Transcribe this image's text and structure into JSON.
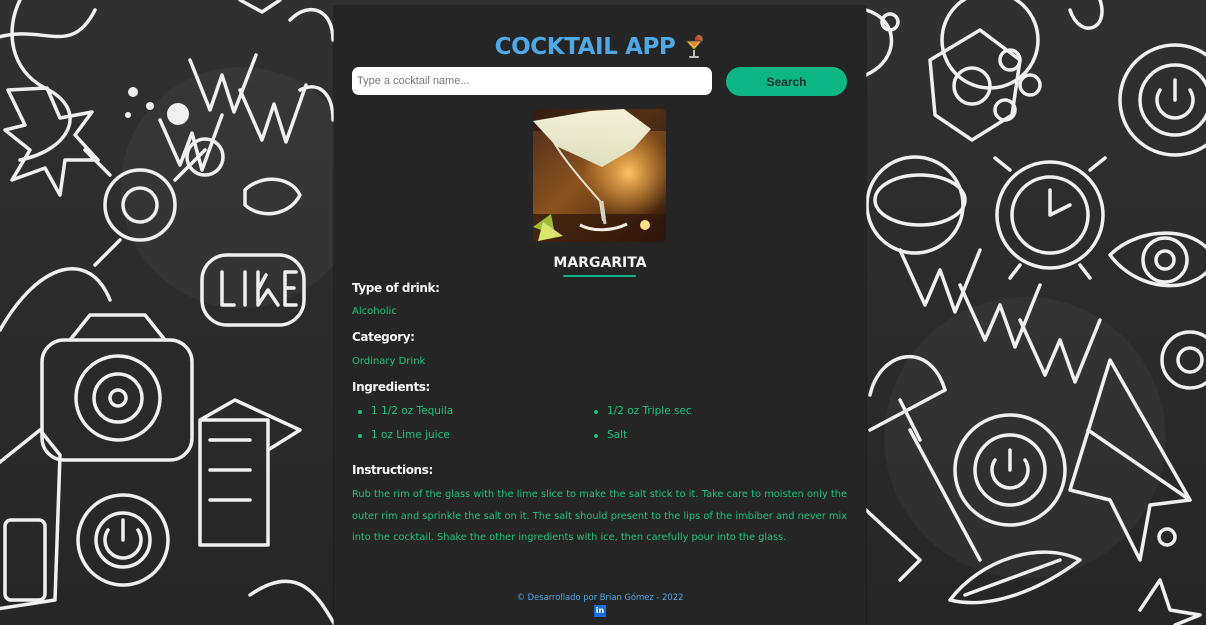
{
  "app": {
    "title": "COCKTAIL APP"
  },
  "search": {
    "placeholder": "Type a cocktail name...",
    "button_label": "Search"
  },
  "drink": {
    "name": "MARGARITA",
    "image_icon": "margarita-cocktail-photo"
  },
  "details": {
    "type_label": "Type of drink:",
    "type_value": "Alcoholic",
    "category_label": "Category:",
    "category_value": "Ordinary Drink",
    "ingredients_label": "Ingredients:",
    "ingredients": [
      "1 1/2 oz Tequila",
      "1/2 oz Triple sec",
      "1 oz Lime juice",
      "Salt"
    ],
    "instructions_label": "Instructions:",
    "instructions": "Rub the rim of the glass with the lime slice to make the salt stick to it. Take care to moisten only the outer rim and sprinkle the salt on it. The salt should present to the lips of the imbiber and never mix into the cocktail. Shake the other ingredients with ice, then carefully pour into the glass."
  },
  "footer": {
    "text": "© Desarrollado por Brian Gómez - 2022",
    "linkedin_label": "in"
  },
  "colors": {
    "accent_blue": "#4ea8e6",
    "accent_green": "#20c27f",
    "button_green": "#0fb685",
    "panel": "#252525"
  }
}
